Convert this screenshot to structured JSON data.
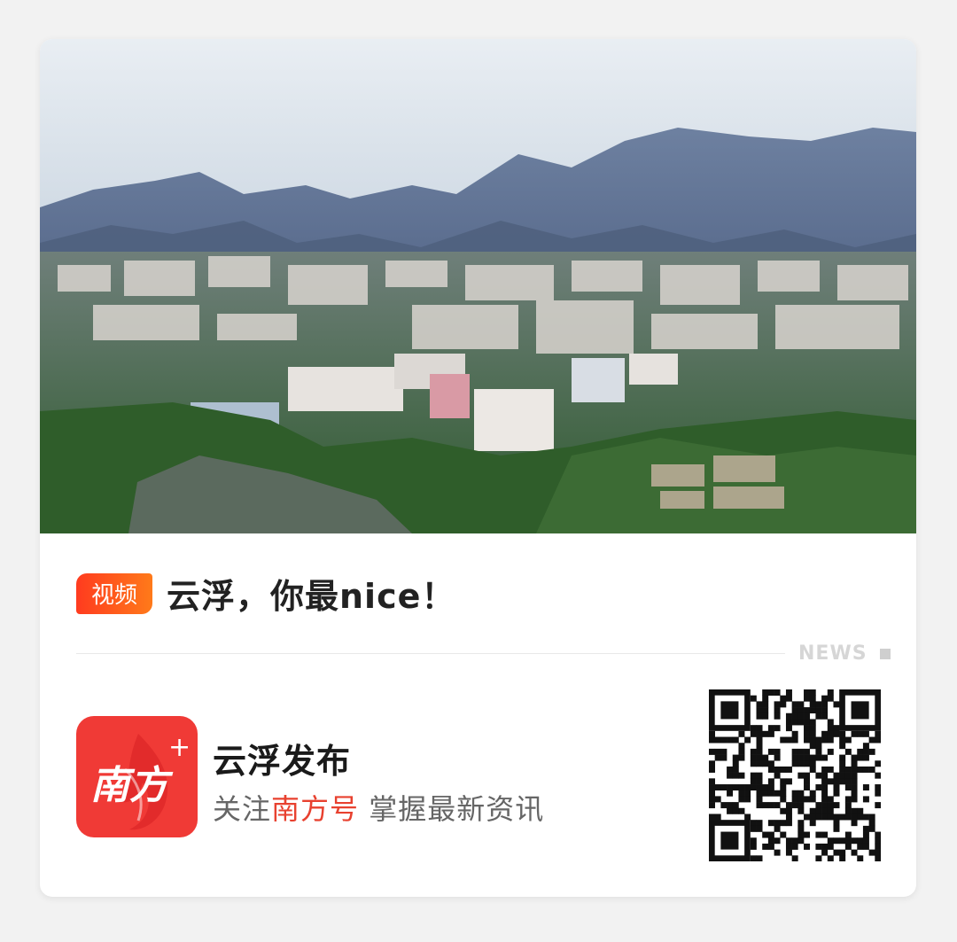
{
  "hero": {
    "image_subject": "city-in-mountain-valley-photo"
  },
  "article": {
    "badge_label": "视频",
    "title": "云浮，你最nice！"
  },
  "section_tag": "NEWS",
  "account": {
    "logo_text": "南方",
    "logo_plus": "+",
    "name": "云浮发布",
    "desc_prefix": "关注",
    "desc_highlight": "南方号",
    "desc_suffix": " 掌握最新资讯"
  },
  "colors": {
    "badge_start": "#ff3b1f",
    "badge_end": "#ff7a1a",
    "highlight": "#e8412f",
    "logo_bg": "#f03a36"
  },
  "qr": {
    "icon": "qr-code-icon"
  }
}
